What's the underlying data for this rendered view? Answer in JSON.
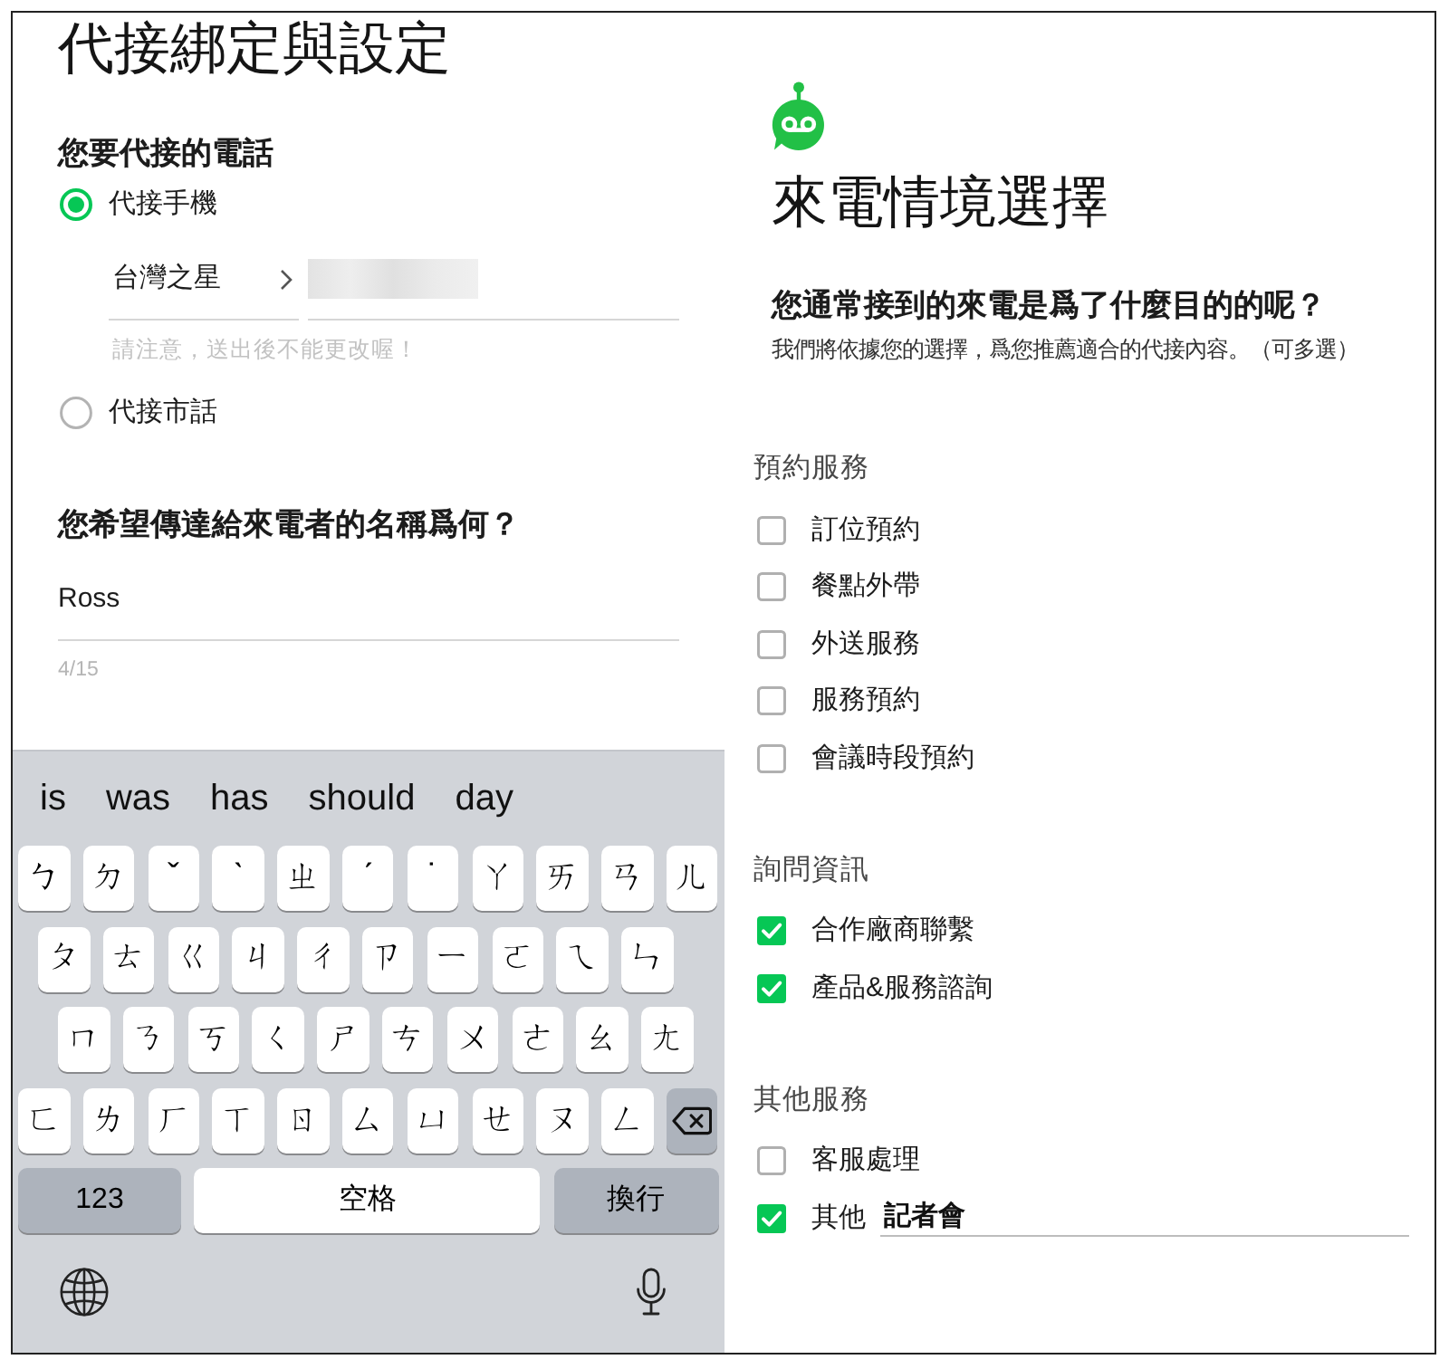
{
  "left_screen": {
    "title": "代接綁定與設定",
    "phone_section": {
      "heading": "您要代接的電話",
      "options": [
        {
          "label": "代接手機",
          "selected": true,
          "carrier": "台灣之星",
          "note": "請注意，送出後不能更改喔！"
        },
        {
          "label": "代接市話",
          "selected": false
        }
      ]
    },
    "name_section": {
      "heading": "您希望傳達給來電者的名稱爲何？",
      "value": "Ross",
      "counter": "4/15"
    }
  },
  "keyboard": {
    "suggestions": [
      "is",
      "was",
      "has",
      "should",
      "day"
    ],
    "rows": [
      [
        "ㄅ",
        "ㄉ",
        "ˇ",
        "ˋ",
        "ㄓ",
        "ˊ",
        "˙",
        "ㄚ",
        "ㄞ",
        "ㄢ",
        "ㄦ"
      ],
      [
        "ㄆ",
        "ㄊ",
        "ㄍ",
        "ㄐ",
        "ㄔ",
        "ㄗ",
        "ㄧ",
        "ㄛ",
        "ㄟ",
        "ㄣ"
      ],
      [
        "ㄇ",
        "ㄋ",
        "ㄎ",
        "ㄑ",
        "ㄕ",
        "ㄘ",
        "ㄨ",
        "ㄜ",
        "ㄠ",
        "ㄤ"
      ],
      [
        "ㄈ",
        "ㄌ",
        "ㄏ",
        "ㄒ",
        "ㄖ",
        "ㄙ",
        "ㄩ",
        "ㄝ",
        "ㄡ",
        "ㄥ"
      ]
    ],
    "bottom_row": [
      {
        "kind": "numbers",
        "label": "123"
      },
      {
        "kind": "space",
        "label": "空格"
      },
      {
        "kind": "return",
        "label": "換行"
      }
    ]
  },
  "right_screen": {
    "title": "來電情境選擇",
    "question": "您通常接到的來電是爲了什麼目的的呢？",
    "hint": "我們將依據您的選擇，爲您推薦適合的代接內容。（可多選）",
    "groups": [
      {
        "heading": "預約服務",
        "options": [
          {
            "kind": "option",
            "label": "訂位預約",
            "checked": false
          },
          {
            "kind": "option",
            "label": "餐點外帶",
            "checked": false
          },
          {
            "kind": "option",
            "label": "外送服務",
            "checked": false
          },
          {
            "kind": "option",
            "label": "服務預約",
            "checked": false
          },
          {
            "kind": "option",
            "label": "會議時段預約",
            "checked": false
          }
        ]
      },
      {
        "heading": "詢問資訊",
        "options": [
          {
            "kind": "option",
            "label": "合作廠商聯繫",
            "checked": true
          },
          {
            "kind": "option",
            "label": "產品&服務諮詢",
            "checked": true
          }
        ]
      },
      {
        "heading": "其他服務",
        "options": [
          {
            "kind": "option",
            "label": "客服處理",
            "checked": false
          },
          {
            "kind": "other",
            "label": "其他",
            "checked": true,
            "value": "記者會"
          }
        ]
      }
    ]
  }
}
